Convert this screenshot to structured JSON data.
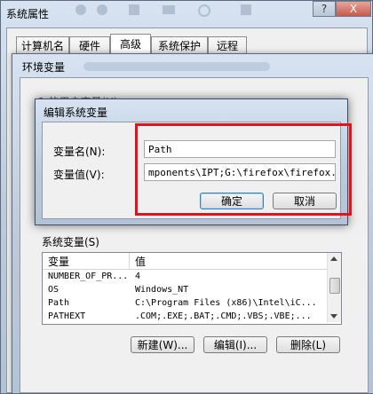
{
  "system_props": {
    "title": "系统属性",
    "tabs": [
      "计算机名",
      "硬件",
      "高级",
      "系统保护",
      "远程"
    ],
    "active_tab": 2,
    "ok_label": "确定",
    "cancel_label": "取消"
  },
  "env_vars": {
    "title": "环境变量",
    "user_vars_label_partial": "1 的用户变量(U)",
    "system_vars_label": "系统变量(S)",
    "columns": [
      "变量",
      "值"
    ],
    "rows": [
      {
        "name": "NUMBER_OF_PR...",
        "value": "4"
      },
      {
        "name": "OS",
        "value": "Windows_NT"
      },
      {
        "name": "Path",
        "value": "C:\\Program Files (x86)\\Intel\\iC..."
      },
      {
        "name": "PATHEXT",
        "value": ".COM;.EXE;.BAT;.CMD;.VBS;.VBE;..."
      }
    ],
    "new_label": "新建(W)...",
    "edit_label": "编辑(I)...",
    "delete_label": "删除(L)"
  },
  "edit_dialog": {
    "title": "编辑系统变量",
    "name_label": "变量名(N):",
    "value_label": "变量值(V):",
    "name_value": "Path",
    "value_value": "mponents\\IPT;G:\\firefox\\firefox.exe",
    "ok_label": "确定",
    "cancel_label": "取消"
  },
  "title_controls": {
    "help": "?",
    "close": "X"
  },
  "colors": {
    "highlight": "#e0141f",
    "glass": "#bccadb"
  }
}
